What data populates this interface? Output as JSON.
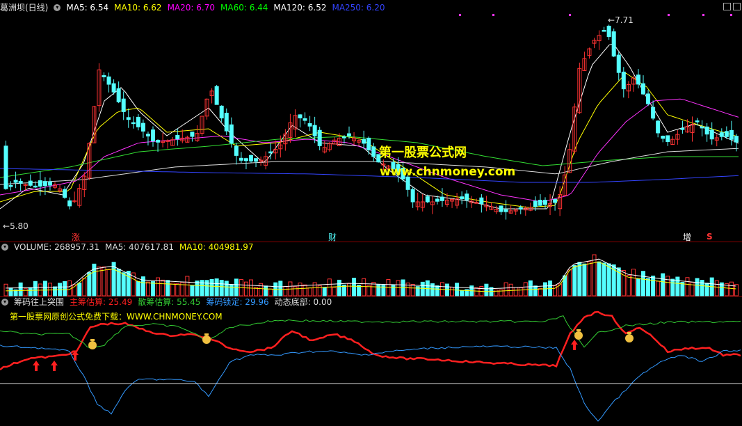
{
  "main": {
    "title": "葛洲坝(日线)",
    "ma": [
      {
        "text": "MA5: 6.54",
        "color": "#ffffff"
      },
      {
        "text": "MA10: 6.62",
        "color": "#ffff00"
      },
      {
        "text": "MA20: 6.70",
        "color": "#ff00ff"
      },
      {
        "text": "MA60: 6.44",
        "color": "#00ff00"
      },
      {
        "text": "MA120: 6.52",
        "color": "#ffffff"
      },
      {
        "text": "MA250: 6.20",
        "color": "#3344ff"
      }
    ],
    "high_label": "7.71",
    "low_label": "5.80",
    "markers": {
      "zhang": "涨",
      "cai": "财",
      "zeng": "增",
      "s": "S"
    }
  },
  "volume": {
    "title": "VOLUME: 268957.31",
    "ma5": "MA5: 407617.81",
    "ma10": "MA10: 404981.97"
  },
  "indicator": {
    "title": "筹码往上突围",
    "items": [
      {
        "text": "主筹估算: 25.49",
        "color": "#ff2020"
      },
      {
        "text": "散筹估算: 55.45",
        "color": "#33cc33"
      },
      {
        "text": "筹码锁定: 29.96",
        "color": "#3399ff"
      },
      {
        "text": "动态底部: 0.00",
        "color": "#dddddd"
      }
    ],
    "promo": "第一股票网原创公式免费下载：WWW.CHNMONEY.COM"
  },
  "watermark": {
    "line1": "第一股票公式网",
    "line2": "www.chnmoney.com"
  },
  "colors": {
    "up": "#ff3333",
    "down": "#54ffff",
    "grid": "#8a0000"
  }
}
